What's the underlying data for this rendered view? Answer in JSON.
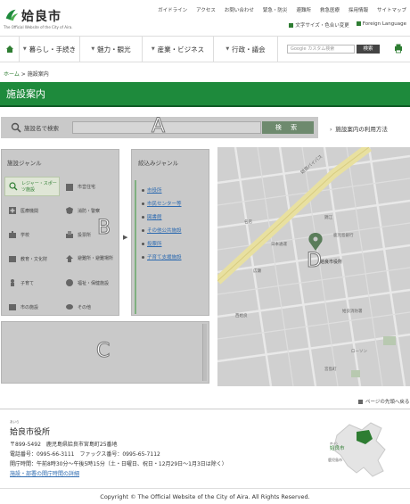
{
  "site": {
    "name": "姶良市",
    "subtitle": "The Official Website of the City of Aira."
  },
  "util_nav": [
    "ガイドライン",
    "アクセス",
    "お問い合わせ",
    "緊急・防災",
    "避難所",
    "救急医療",
    "採用情報",
    "サイトマップ"
  ],
  "util_nav2": [
    "文字サイズ・色合い変更",
    "Foreign Language"
  ],
  "global_nav": {
    "items": [
      "暮らし・手続き",
      "魅力・観光",
      "産業・ビジネス",
      "行政・議会"
    ],
    "search_placeholder": "Google カスタム検索",
    "search_button": "検索"
  },
  "breadcrumb": {
    "home": "ホーム",
    "separator": ">",
    "current": "施設案内"
  },
  "page_title": "施設案内",
  "facility_search": {
    "label": "施設名で検索",
    "button": "検 索",
    "marker": "A"
  },
  "help_link": "施設案内の利用方法",
  "genre_panel": {
    "heading": "施設ジャンル",
    "marker": "B",
    "items": [
      {
        "label": "レジャー・スポーツ施設",
        "icon": "tennis-racket-icon",
        "active": true
      },
      {
        "label": "市営住宅",
        "icon": "apartment-icon",
        "active": false
      },
      {
        "label": "医療機関",
        "icon": "hospital-icon",
        "active": false
      },
      {
        "label": "消防・警察",
        "icon": "police-icon",
        "active": false
      },
      {
        "label": "学校",
        "icon": "school-icon",
        "active": false
      },
      {
        "label": "投票所",
        "icon": "ballot-icon",
        "active": false
      },
      {
        "label": "教育・文化財",
        "icon": "book-icon",
        "active": false
      },
      {
        "label": "避難所・避難場所",
        "icon": "shelter-icon",
        "active": false
      },
      {
        "label": "子育て",
        "icon": "child-icon",
        "active": false
      },
      {
        "label": "福祉・保健施設",
        "icon": "welfare-icon",
        "active": false
      },
      {
        "label": "市の施設",
        "icon": "city-facility-icon",
        "active": false
      },
      {
        "label": "その他",
        "icon": "other-icon",
        "active": false
      }
    ]
  },
  "narrow_panel": {
    "heading": "絞込みジャンル",
    "items": [
      "市役所",
      "市民センター等",
      "図書館",
      "その他公共施設",
      "投票所",
      "子育て支援施設"
    ]
  },
  "results_panel": {
    "marker": "C"
  },
  "map": {
    "marker": "D",
    "pin_label": "姶良市役所",
    "labels": [
      "姶良バイパス",
      "名店",
      "日本通運",
      "鹿児島銀行",
      "錦江",
      "広瀬",
      "姶良市役所",
      "姶良消防署",
      "西姶良",
      "ローソン",
      "宮島町"
    ],
    "colors": {
      "land": "#e8e8e8",
      "road": "#ffffff",
      "highway": "#f2e27a",
      "park": "#b9e0a5",
      "pin": "#2e7d32"
    }
  },
  "page_top": "ページの先頭へ戻る",
  "footer": {
    "ruby": "あいら",
    "title": "姶良市役所",
    "postal": "〒899-5492　鹿児島県姶良市宮島町25番地",
    "phone": "電話番号：0995-66-3111　ファックス番号：0995-65-7112",
    "hours": "開庁時間：午前8時30分～午後5時15分（土・日曜日、祝日・12月29日～1月3日は除く）",
    "hours_link": "施設・部署の開庁時間の詳細",
    "map_city": "姶良市",
    "map_sub": "鹿児島市"
  },
  "copyright": "Copyright © The Official Website of the City of Aira. All Rights Reserved.",
  "colors": {
    "brand_green": "#1e8a3c",
    "link_blue": "#2e6bb0",
    "overlay_gray": "#c9c9c9"
  }
}
